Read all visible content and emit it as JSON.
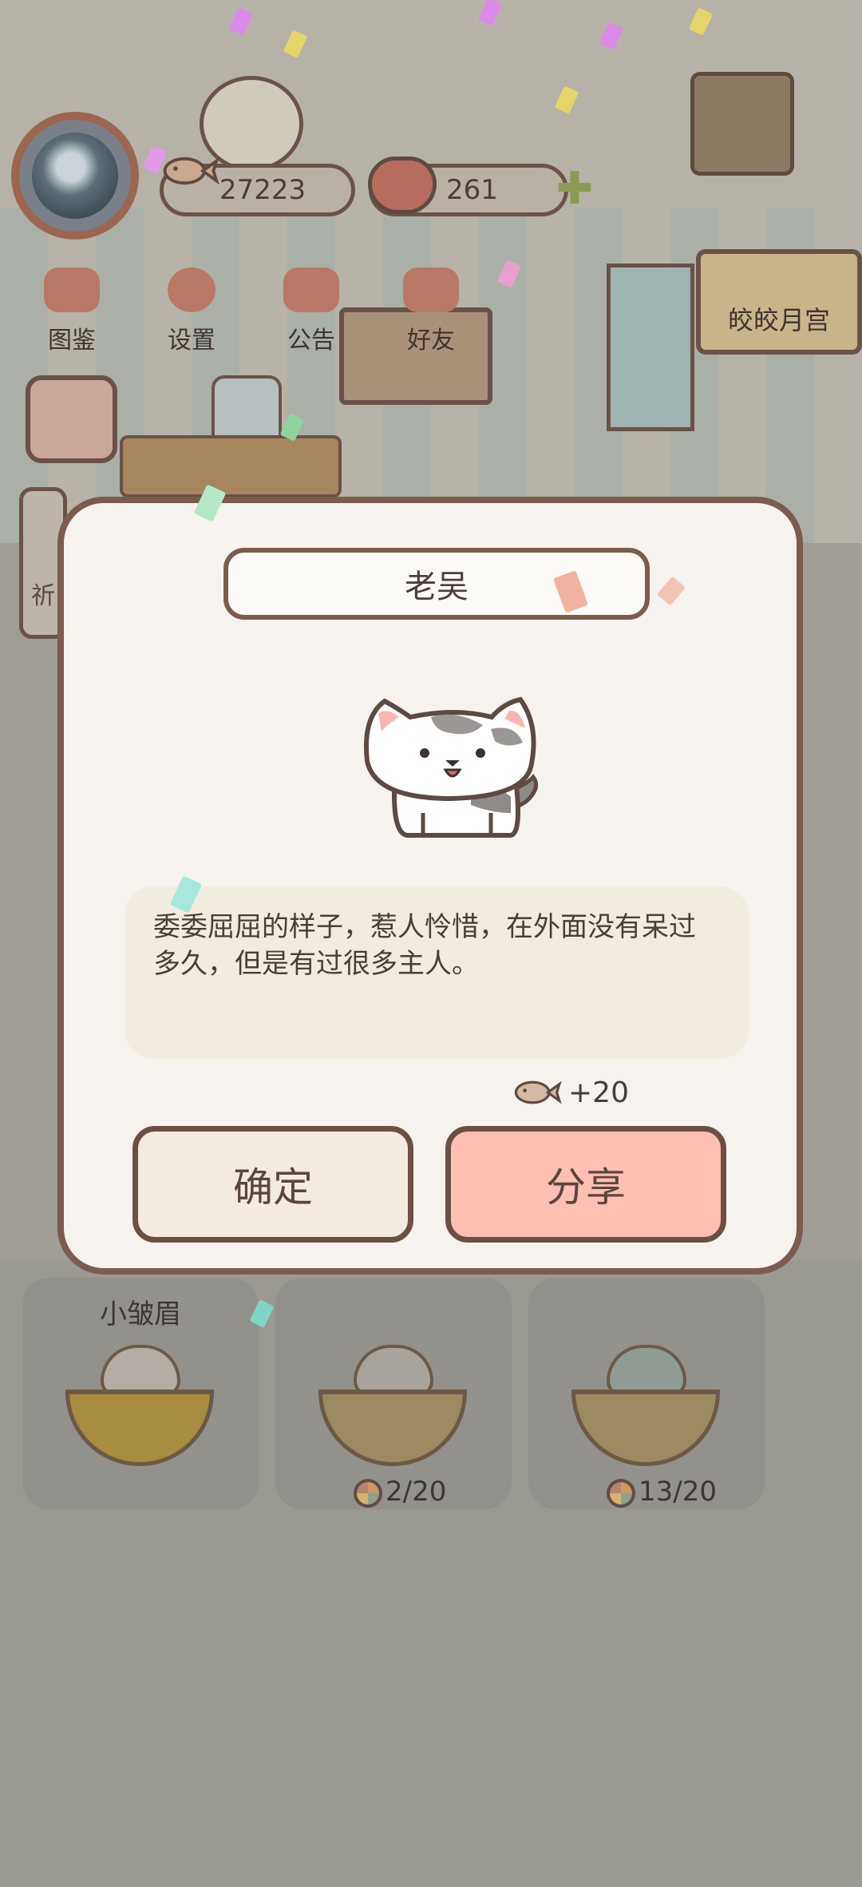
{
  "hud": {
    "fish_count": "27223",
    "heart_count": "261"
  },
  "menu": [
    {
      "label": "图鉴"
    },
    {
      "label": "设置"
    },
    {
      "label": "公告"
    },
    {
      "label": "好友"
    }
  ],
  "banner": {
    "label": "皎皎月宫"
  },
  "side_label": "祈",
  "dialog": {
    "cat_name": "老吴",
    "description": "委委屈屈的样子，惹人怜惜，在外面没有呆过多久，但是有过很多主人。",
    "reward": "+20",
    "confirm_label": "确定",
    "share_label": "分享"
  },
  "bowls": [
    {
      "name": "小皱眉",
      "count": ""
    },
    {
      "name": "",
      "count": "2/20"
    },
    {
      "name": "",
      "count": "13/20"
    }
  ],
  "colors": {
    "dialog_border": "#7b5c4f",
    "share_button": "#ffbfb2",
    "confirm_button": "#f3ebdf"
  }
}
